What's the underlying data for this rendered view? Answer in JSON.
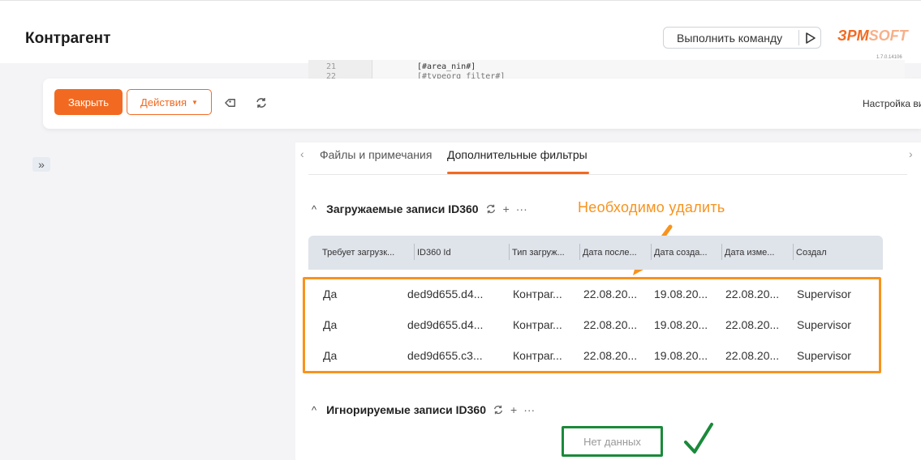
{
  "header": {
    "title": "Контрагент",
    "run_command_label": "Выполнить команду",
    "logo_part1": "ЗPM",
    "logo_part2": "SOFT",
    "version": "1.7.0.14106"
  },
  "code_peek": {
    "line1_no": "21",
    "line1": "[#area_nin#]",
    "line2_no": "22",
    "line2": "[#typeorg_filter#]"
  },
  "toolbar": {
    "close_label": "Закрыть",
    "actions_label": "Действия",
    "view_settings_label": "Настройка вид"
  },
  "tabs": {
    "items": [
      {
        "label": "Файлы и примечания"
      },
      {
        "label": "Дополнительные фильтры"
      }
    ],
    "active_index": 1
  },
  "loaded_section": {
    "title": "Загружаемые записи ID360",
    "annotation": "Необходимо удалить",
    "columns": [
      "Требует загрузк...",
      "ID360 Id",
      "Тип загруж...",
      "Дата после...",
      "Дата созда...",
      "Дата изме...",
      "Создал"
    ],
    "rows": [
      [
        "Да",
        "ded9d655.d4...",
        "Контраг...",
        "22.08.20...",
        "19.08.20...",
        "22.08.20...",
        "Supervisor"
      ],
      [
        "Да",
        "ded9d655.d4...",
        "Контраг...",
        "22.08.20...",
        "19.08.20...",
        "22.08.20...",
        "Supervisor"
      ],
      [
        "Да",
        "ded9d655.c3...",
        "Контраг...",
        "22.08.20...",
        "19.08.20...",
        "22.08.20...",
        "Supervisor"
      ]
    ]
  },
  "ignored_section": {
    "title": "Игнорируемые записи ID360",
    "empty_text": "Нет данных"
  },
  "icons": {
    "play": "play-icon",
    "tag": "tag-icon",
    "sync": "sync-icon",
    "expand": "double-chevron-right-icon",
    "add": "plus-icon",
    "more": "more-icon",
    "check": "check-icon"
  },
  "colors": {
    "accent": "#f26a21",
    "annotation_orange": "#f7931e",
    "annotation_green": "#1a8a3a"
  }
}
